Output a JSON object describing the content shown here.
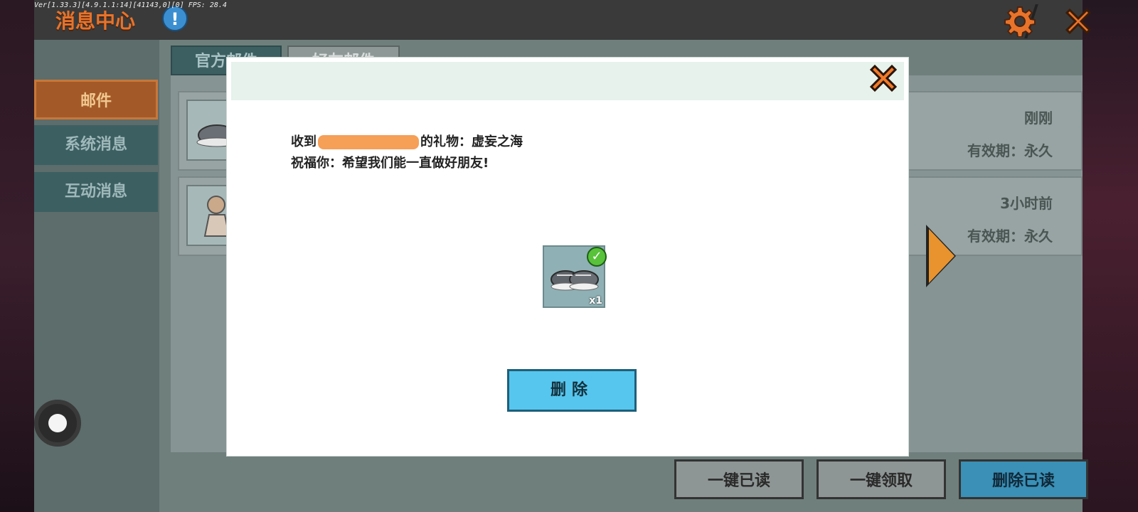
{
  "debug": {
    "version_text": "Ver[1.33.3][4.9.1.1:14][41143,0][0] FPS: 28.4"
  },
  "header": {
    "title": "消息中心",
    "info_label": "!"
  },
  "sidebar": {
    "items": [
      {
        "label": "邮件"
      },
      {
        "label": "系统消息"
      },
      {
        "label": "互动消息"
      }
    ]
  },
  "tabs": [
    {
      "label": "官方邮件"
    },
    {
      "label": "好友邮件"
    }
  ],
  "mails": [
    {
      "time": "刚刚",
      "validity": "有效期：永久"
    },
    {
      "time": "3小时前",
      "validity": "有效期：永久"
    }
  ],
  "bottom_buttons": {
    "read_all": "一键已读",
    "claim_all": "一键领取",
    "delete_read": "删除已读"
  },
  "modal": {
    "line1_prefix": "收到",
    "line1_suffix": "的礼物：虚妄之海",
    "line2": "祝福你：希望我们能一直做好朋友!",
    "gift_qty": "x1",
    "delete_label": "删除"
  },
  "colors": {
    "accent_orange": "#e8732a",
    "modal_button": "#56c6ee",
    "check_green": "#57c23a"
  }
}
